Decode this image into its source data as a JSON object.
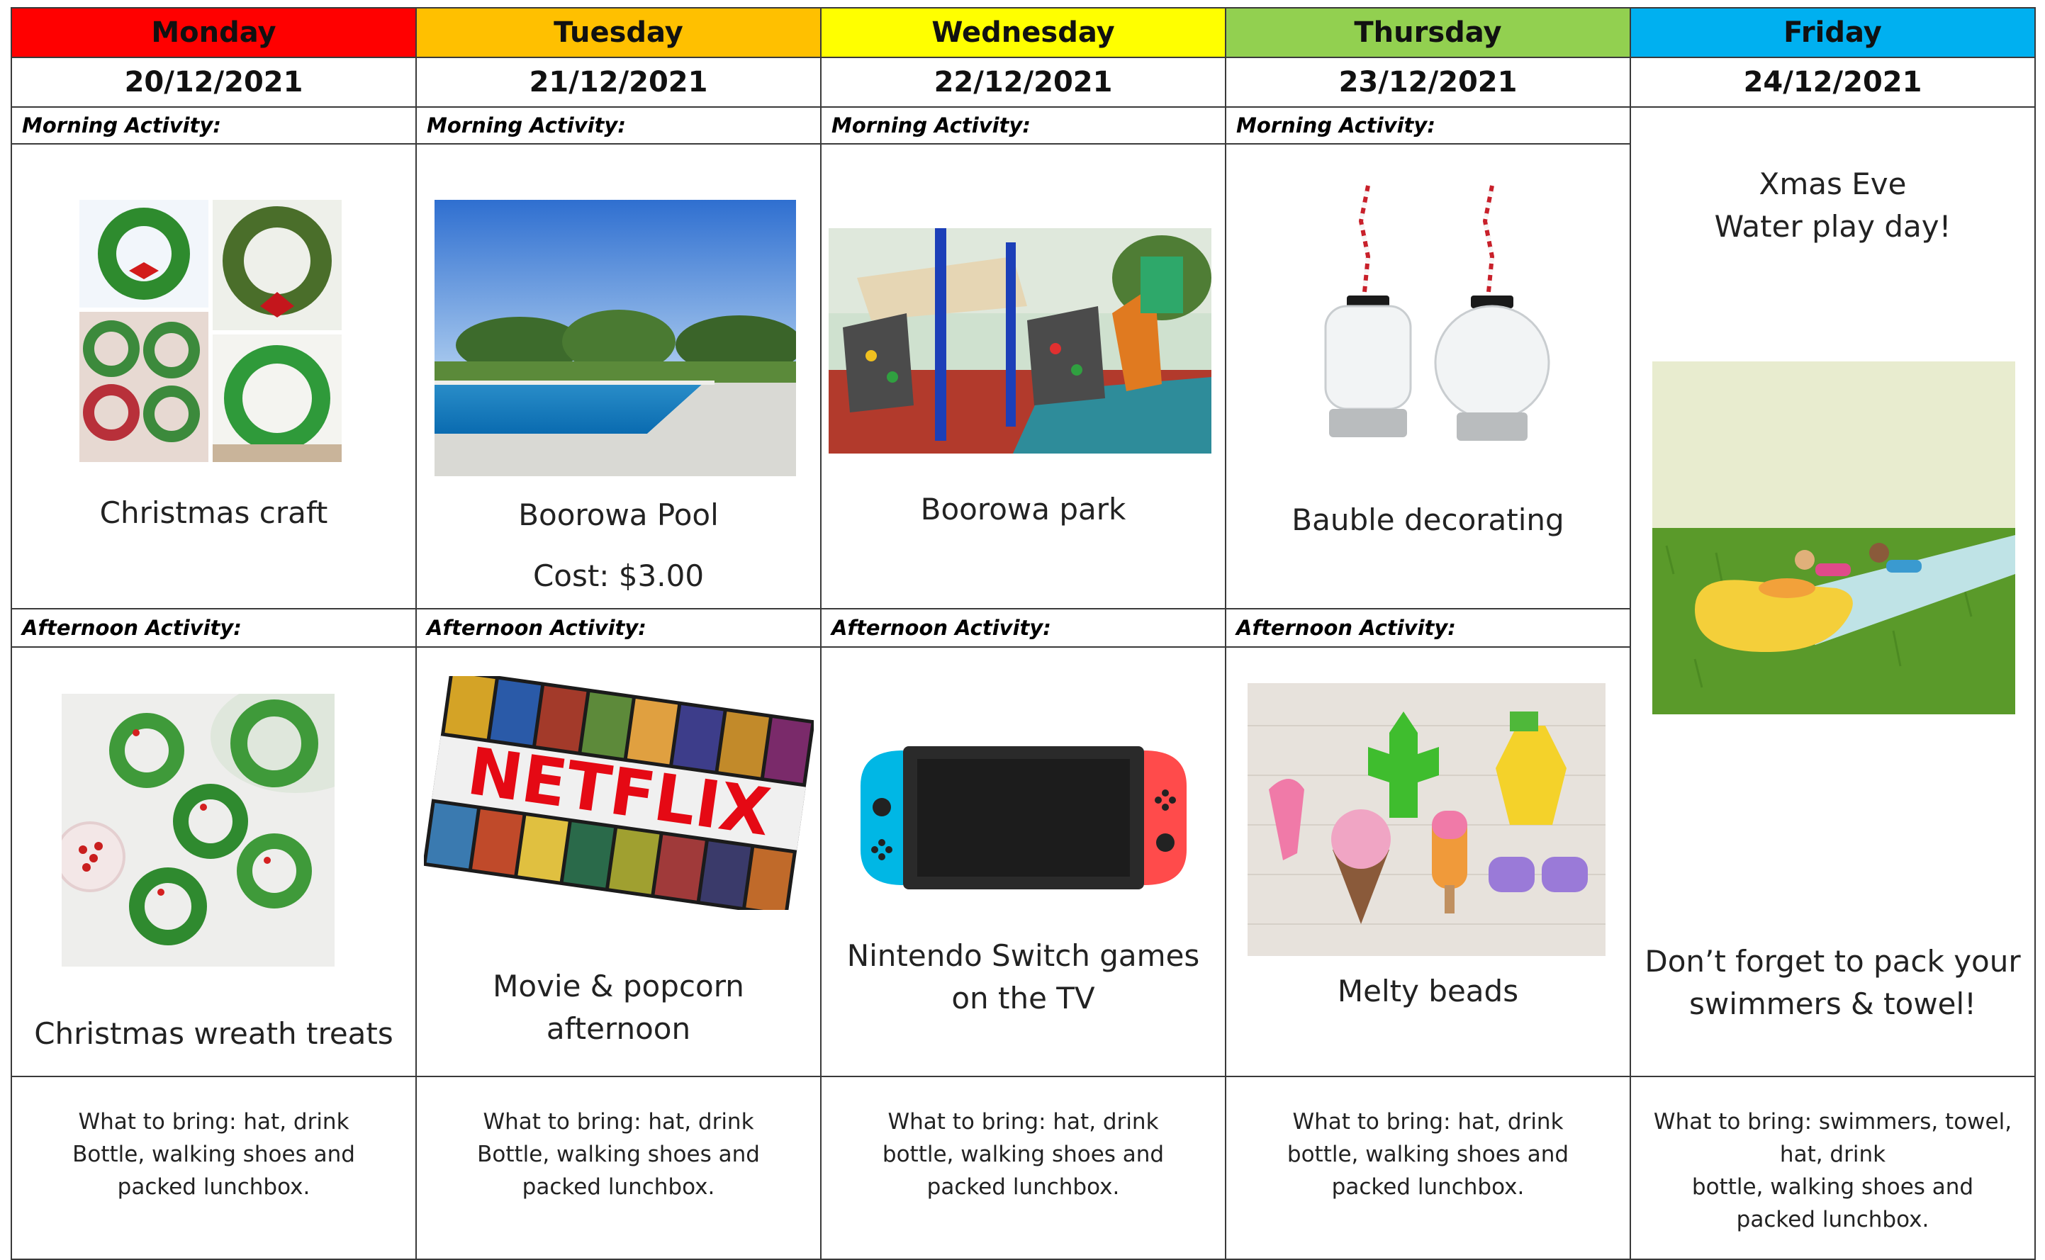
{
  "colors": {
    "monday": "#ff0000",
    "tuesday": "#ffc000",
    "wednesday": "#ffff00",
    "thursday": "#92d050",
    "friday": "#00b0f0"
  },
  "days": [
    {
      "name": "Monday",
      "date": "20/12/2021",
      "morning_label": "Morning Activity:",
      "morning_image": "christmas-wreath-craft-collage",
      "morning_caption": [
        "Christmas craft"
      ],
      "afternoon_label": "Afternoon Activity:",
      "afternoon_image": "christmas-wreath-treats-photo",
      "afternoon_caption": [
        "Christmas wreath treats"
      ],
      "bring": [
        "What to bring: hat, drink",
        "Bottle, walking shoes and",
        "packed lunchbox."
      ]
    },
    {
      "name": "Tuesday",
      "date": "21/12/2021",
      "morning_label": "Morning Activity:",
      "morning_image": "swimming-pool-photo",
      "morning_caption": [
        "Boorowa Pool",
        "Cost: $3.00"
      ],
      "afternoon_label": "Afternoon Activity:",
      "afternoon_image": "netflix-poster-collage",
      "afternoon_image_text": "NETFLIX",
      "afternoon_caption": [
        "Movie & popcorn",
        "afternoon"
      ],
      "bring": [
        "What to bring: hat, drink",
        "Bottle, walking shoes and",
        "packed lunchbox."
      ]
    },
    {
      "name": "Wednesday",
      "date": "22/12/2021",
      "morning_label": "Morning Activity:",
      "morning_image": "playground-photo",
      "morning_caption": [
        "Boorowa park"
      ],
      "afternoon_label": "Afternoon Activity:",
      "afternoon_image": "nintendo-switch-console",
      "afternoon_caption": [
        "Nintendo Switch games",
        "on the TV"
      ],
      "bring": [
        "What to bring: hat, drink",
        "bottle, walking shoes and",
        "packed lunchbox."
      ]
    },
    {
      "name": "Thursday",
      "date": "23/12/2021",
      "morning_label": "Morning Activity:",
      "morning_image": "clear-bauble-ornaments",
      "morning_caption": [
        "Bauble decorating"
      ],
      "afternoon_label": "Afternoon Activity:",
      "afternoon_image": "melty-bead-shapes",
      "afternoon_caption": [
        "Melty beads"
      ],
      "bring": [
        "What to bring: hat, drink",
        "bottle, walking shoes and",
        "packed lunchbox."
      ]
    },
    {
      "name": "Friday",
      "date": "24/12/2021",
      "headline": [
        "Xmas Eve",
        "Water play day!"
      ],
      "image": "water-slide-photo",
      "reminder": [
        "Don’t forget to pack your",
        "swimmers & towel!"
      ],
      "bring": [
        "What to bring: swimmers, towel,",
        "hat, drink",
        "bottle, walking shoes and",
        "packed lunchbox."
      ]
    }
  ]
}
